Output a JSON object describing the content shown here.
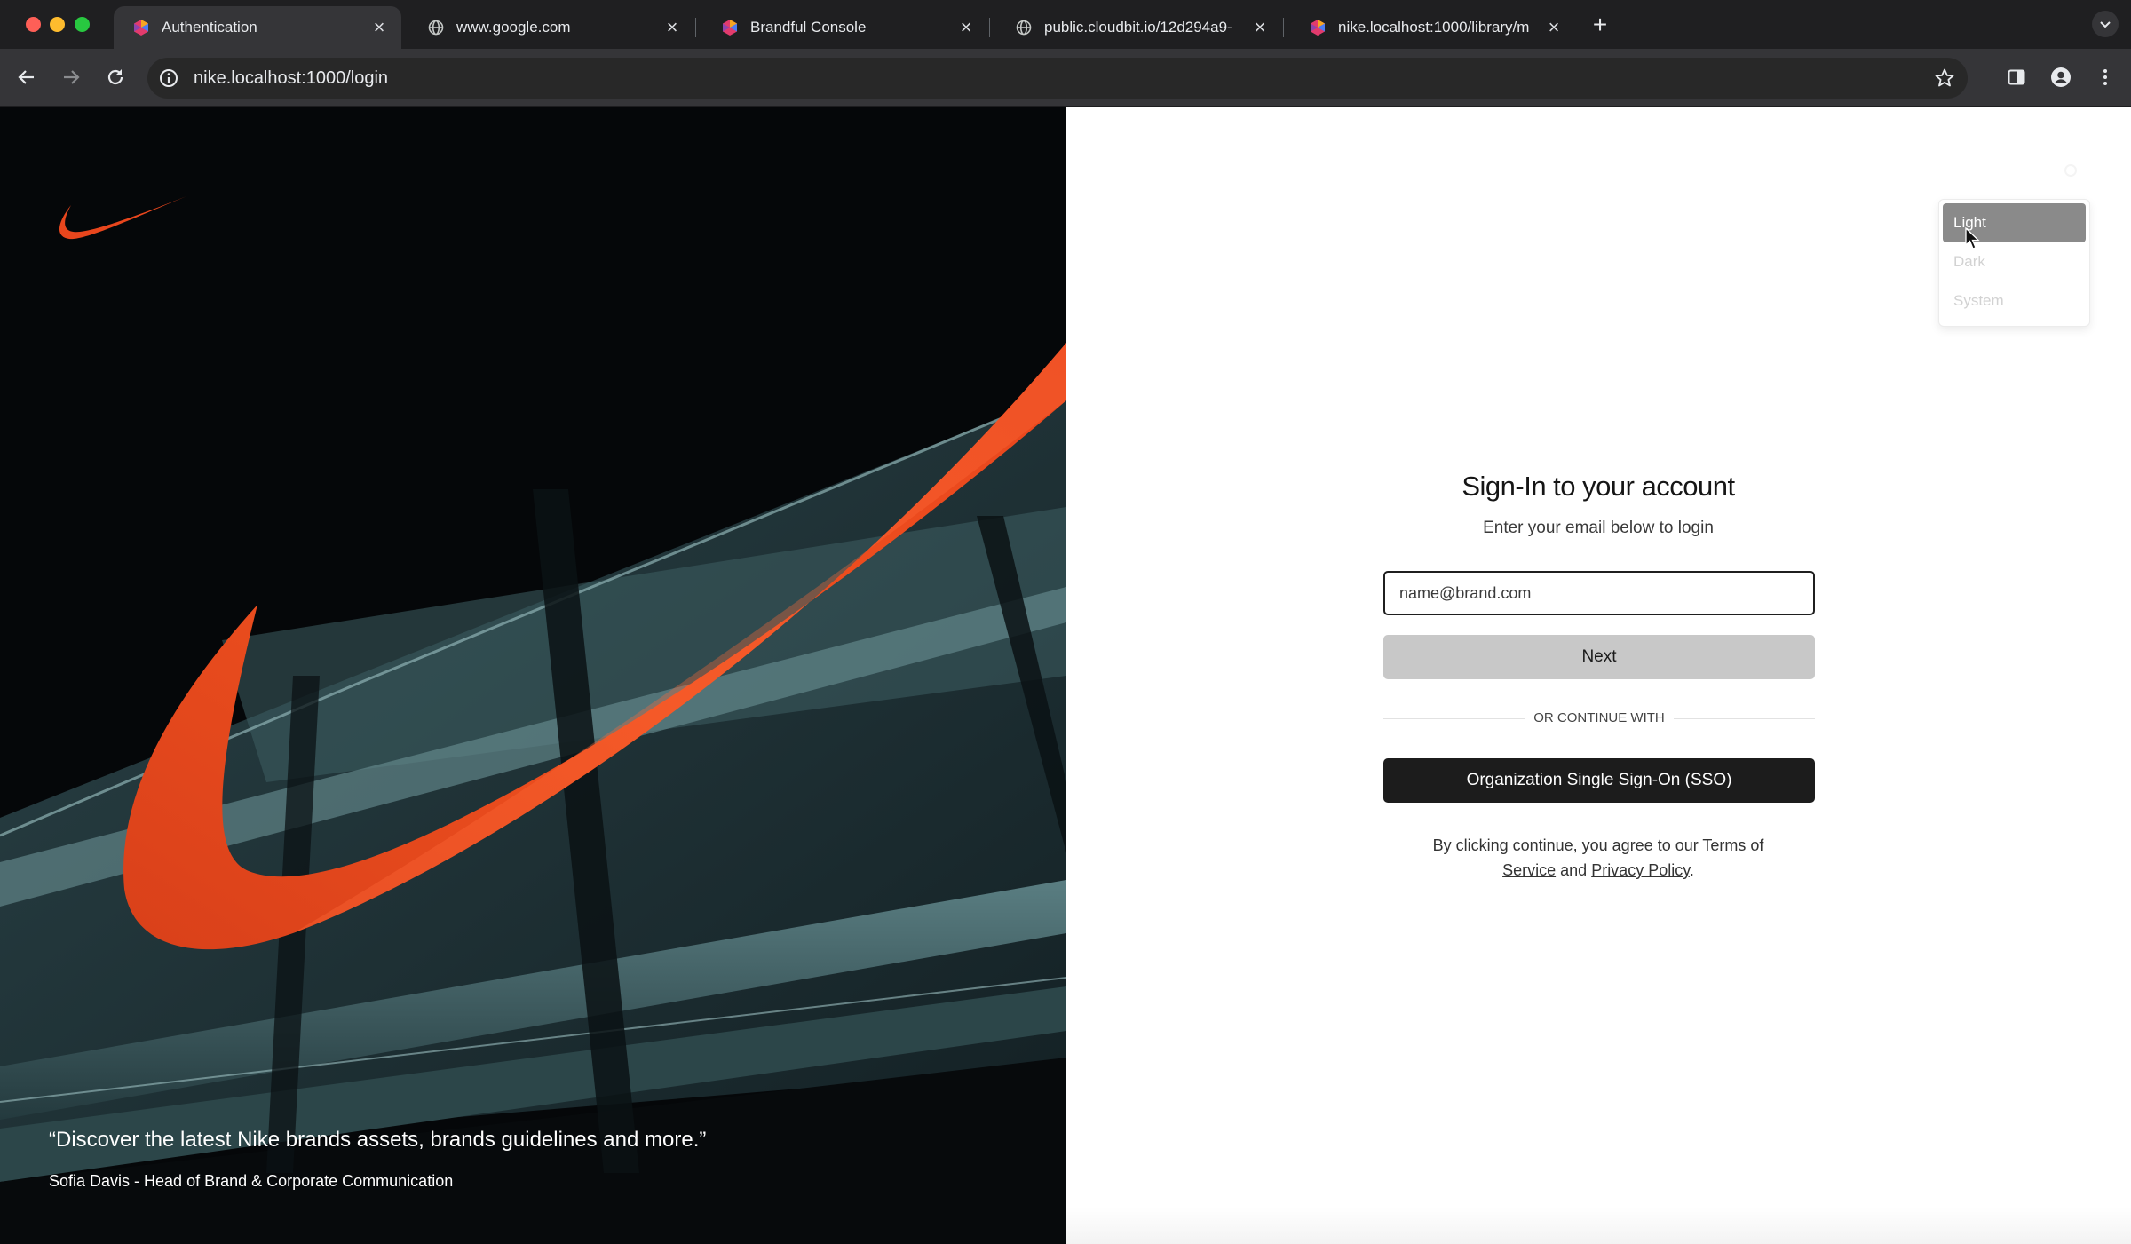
{
  "browser": {
    "tabs": [
      {
        "title": "Authentication",
        "active": true,
        "favicon": "brandful-logo-icon"
      },
      {
        "title": "www.google.com",
        "active": false,
        "favicon": "globe-icon"
      },
      {
        "title": "Brandful Console",
        "active": false,
        "favicon": "brandful-logo-icon"
      },
      {
        "title": "public.cloudbit.io/12d294a9-",
        "active": false,
        "favicon": "globe-icon"
      },
      {
        "title": "nike.localhost:1000/library/m",
        "active": false,
        "favicon": "brandful-logo-icon"
      }
    ],
    "url": "nike.localhost:1000/login"
  },
  "hero": {
    "quote": "“Discover the latest Nike brands assets, brands guidelines and more.”",
    "author": "Sofia Davis - Head of Brand & Corporate Communication",
    "brand_color": "#e8461d"
  },
  "theme_menu": {
    "items": [
      "Light",
      "Dark",
      "System"
    ],
    "selected": "Light"
  },
  "login": {
    "title": "Sign-In to your account",
    "subtitle": "Enter your email below to login",
    "email_placeholder": "name@brand.com",
    "email_value": "",
    "next_label": "Next",
    "divider_label": "OR CONTINUE WITH",
    "sso_label": "Organization Single Sign-On (SSO)",
    "terms_prefix": "By clicking continue, you agree to our",
    "terms_link": "Terms of Service",
    "terms_and": "and",
    "privacy_link": "Privacy Policy",
    "terms_suffix": "."
  }
}
